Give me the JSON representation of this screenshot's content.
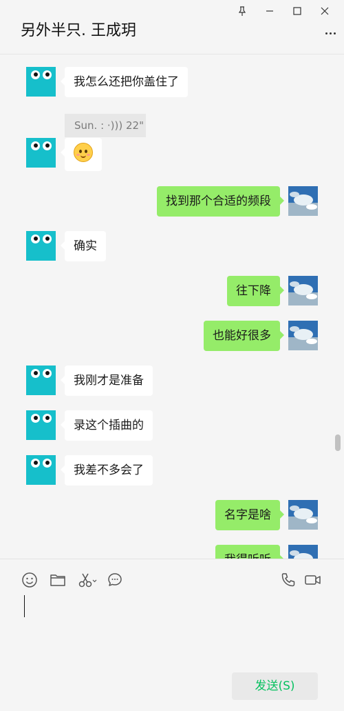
{
  "header": {
    "title": "另外半只. 王成玥"
  },
  "messages": [
    {
      "side": "in",
      "text": "我怎么还把你盖住了"
    },
    {
      "side": "in",
      "voice": "Sun. : ·))) 22\""
    },
    {
      "side": "in",
      "emoji": "smiling-face-emoji"
    },
    {
      "side": "out",
      "text": "找到那个合适的频段"
    },
    {
      "side": "in",
      "text": "确实"
    },
    {
      "side": "out",
      "text": "往下降"
    },
    {
      "side": "out",
      "text": "也能好很多"
    },
    {
      "side": "in",
      "text": "我刚才是准备"
    },
    {
      "side": "in",
      "text": "录这个插曲的"
    },
    {
      "side": "in",
      "text": "我差不多会了"
    },
    {
      "side": "out",
      "text": "名字是啥"
    },
    {
      "side": "out",
      "text": "我得听听"
    }
  ],
  "toolbar": {
    "icons": [
      "emoji-icon",
      "folder-icon",
      "scissors-icon",
      "chat-icon",
      "phone-icon",
      "video-icon"
    ]
  },
  "input": {
    "value": ""
  },
  "send_button": {
    "label": "发送(S)"
  },
  "colors": {
    "outgoing_bubble": "#95ec69",
    "incoming_bubble": "#ffffff",
    "send_text": "#07c160",
    "avatar": "#16bfcb"
  }
}
